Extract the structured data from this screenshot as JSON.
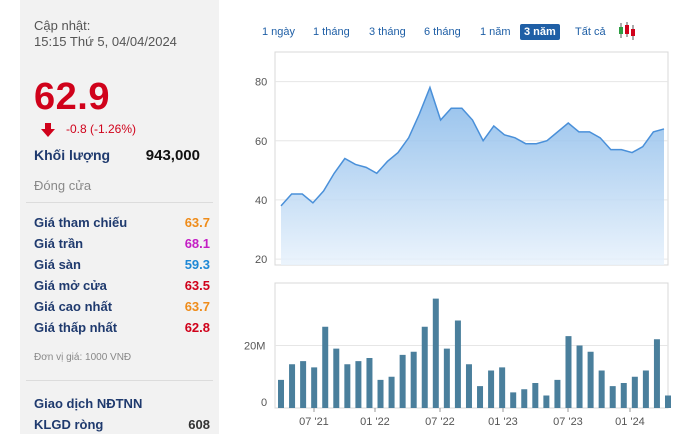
{
  "info": {
    "update_label": "Cập nhật:",
    "update_time": "15:15 Thứ 5, 04/04/2024",
    "price": "62.9",
    "change": "-0.8 (-1.26%)",
    "volume_label": "Khối lượng",
    "volume_value": "943,000",
    "status": "Đóng cửa",
    "unit_note": "Đơn vị giá: 1000 VNĐ",
    "foreign_label": "Giao dịch NĐTNN",
    "net_label": "KLGD ròng",
    "net_value": "608"
  },
  "prices": [
    {
      "label": "Giá tham chiếu",
      "value": "63.7",
      "color": "#ef8c1a"
    },
    {
      "label": "Giá trần",
      "value": "68.1",
      "color": "#c41ec4"
    },
    {
      "label": "Giá sàn",
      "value": "59.3",
      "color": "#1e88d6"
    },
    {
      "label": "Giá mở cửa",
      "value": "63.5",
      "color": "#d0021b"
    },
    {
      "label": "Giá cao nhất",
      "value": "63.7",
      "color": "#ef8c1a"
    },
    {
      "label": "Giá thấp nhất",
      "value": "62.8",
      "color": "#d0021b"
    }
  ],
  "tabs": [
    {
      "label": "1 ngày"
    },
    {
      "label": "1 tháng"
    },
    {
      "label": "3 tháng"
    },
    {
      "label": "6 tháng"
    },
    {
      "label": "1 năm"
    },
    {
      "label": "3 năm",
      "active": true
    },
    {
      "label": "Tất cả"
    }
  ],
  "colors": {
    "down": "#d0021b",
    "accent": "#1f5fa6",
    "area_line": "#4a90d9",
    "volume_bar": "#4a7f9c"
  },
  "chart_data": [
    {
      "type": "area",
      "x": [
        "2021-04",
        "2021-05",
        "2021-06",
        "2021-07",
        "2021-08",
        "2021-09",
        "2021-10",
        "2021-11",
        "2021-12",
        "2022-01",
        "2022-02",
        "2022-03",
        "2022-04",
        "2022-05",
        "2022-06",
        "2022-07",
        "2022-08",
        "2022-09",
        "2022-10",
        "2022-11",
        "2022-12",
        "2023-01",
        "2023-02",
        "2023-03",
        "2023-04",
        "2023-05",
        "2023-06",
        "2023-07",
        "2023-08",
        "2023-09",
        "2023-10",
        "2023-11",
        "2023-12",
        "2024-01",
        "2024-02",
        "2024-03",
        "2024-04"
      ],
      "values": [
        38,
        42,
        42,
        39,
        43,
        49,
        54,
        52,
        51,
        49,
        53,
        56,
        61,
        69,
        78,
        67,
        71,
        71,
        67,
        60,
        65,
        62,
        61,
        59,
        59,
        60,
        63,
        66,
        63,
        63,
        61,
        57,
        57,
        56,
        58,
        63,
        64
      ],
      "ylim": [
        18,
        90
      ],
      "yticks": [
        "20",
        "40",
        "60",
        "80"
      ]
    },
    {
      "type": "bar",
      "values": [
        9,
        14,
        15,
        13,
        26,
        19,
        14,
        15,
        16,
        9,
        10,
        17,
        18,
        26,
        35,
        19,
        28,
        14,
        7,
        12,
        13,
        5,
        6,
        8,
        4,
        9,
        23,
        20,
        18,
        12,
        7,
        8,
        10,
        12,
        22,
        4
      ],
      "ylim": [
        0,
        40
      ],
      "yticks": [
        "0",
        "20M"
      ],
      "xticks": [
        "07 '21",
        "01 '22",
        "07 '22",
        "01 '23",
        "07 '23",
        "01 '24"
      ]
    }
  ]
}
